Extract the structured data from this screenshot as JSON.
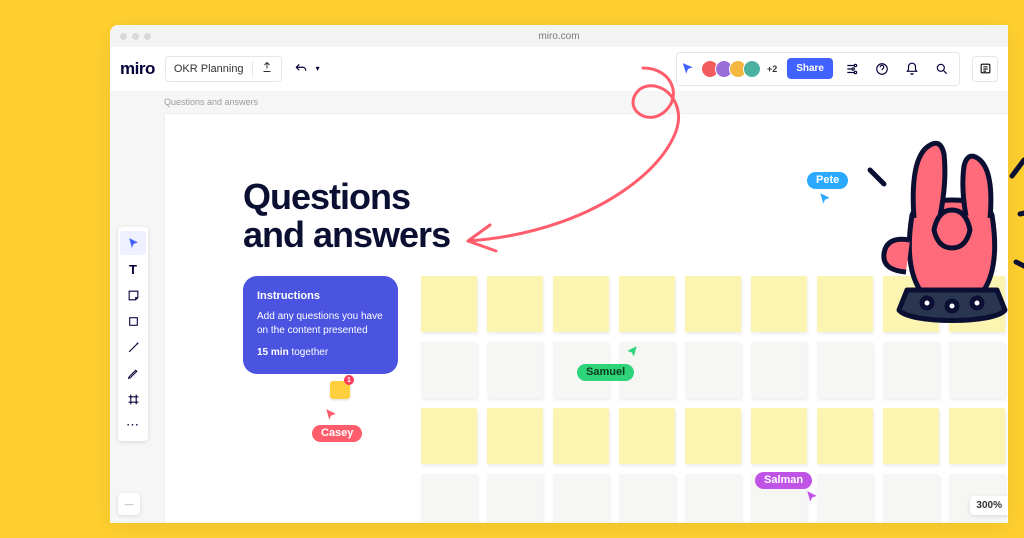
{
  "browser": {
    "url": "miro.com"
  },
  "header": {
    "logo": "miro",
    "board_name": "OKR Planning",
    "plus_count": "+2",
    "share_label": "Share"
  },
  "canvas": {
    "frame_label": "Questions and answers",
    "title_line1": "Questions",
    "title_line2": "and answers"
  },
  "instructions": {
    "heading": "Instructions",
    "body": "Add any questions you have on the content presented",
    "time_bold": "15 min",
    "time_rest": " together"
  },
  "comment": {
    "badge": "1"
  },
  "cursors": {
    "casey": "Casey",
    "samuel": "Samuel",
    "salman": "Salman",
    "pete": "Pete"
  },
  "zoom": "300%",
  "corner": "—"
}
